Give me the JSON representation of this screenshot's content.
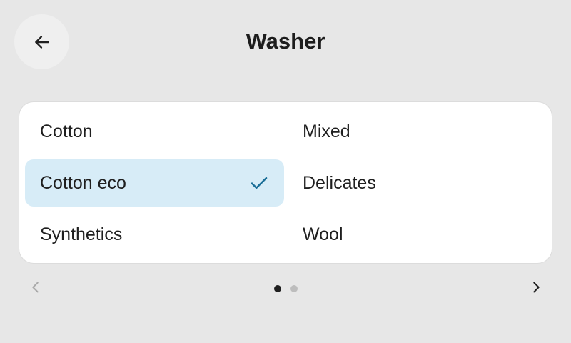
{
  "header": {
    "title": "Washer",
    "back_icon": "arrow-left-icon"
  },
  "programs": {
    "left": [
      {
        "label": "Cotton",
        "selected": false
      },
      {
        "label": "Cotton eco",
        "selected": true
      },
      {
        "label": "Synthetics",
        "selected": false
      }
    ],
    "right": [
      {
        "label": "Mixed",
        "selected": false
      },
      {
        "label": "Delicates",
        "selected": false
      },
      {
        "label": "Wool",
        "selected": false
      }
    ],
    "selected_icon": "checkmark-icon"
  },
  "pager": {
    "current_page": 1,
    "page_count": 2,
    "prev_icon": "chevron-left-icon",
    "next_icon": "chevron-right-icon",
    "prev_enabled": false,
    "next_enabled": true
  },
  "colors": {
    "background": "#e7e7e7",
    "card": "#ffffff",
    "selected_bg": "#d7ecf7",
    "accent": "#1b6f98",
    "text": "#1f1f1f",
    "disabled": "#a9a9a9"
  }
}
